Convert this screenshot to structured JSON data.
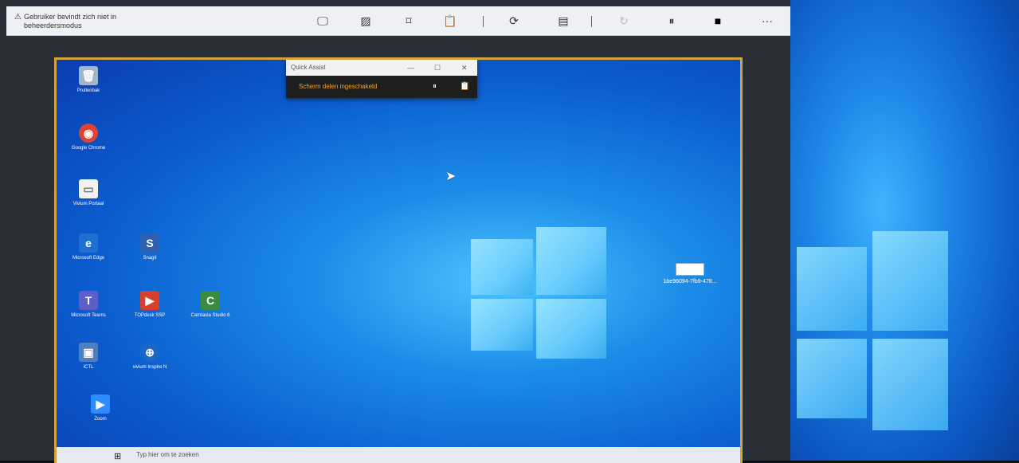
{
  "toolbar": {
    "warning_line1": "Gebruiker bevindt zich niet in",
    "warning_line2": "beheerdersmodus",
    "warning_icon": "⚠",
    "buttons": [
      {
        "name": "monitor-icon",
        "glyph": "🖵"
      },
      {
        "name": "annotate-icon",
        "glyph": "▨"
      },
      {
        "name": "fit-screen-icon",
        "glyph": "⌑"
      },
      {
        "name": "clipboard-icon",
        "glyph": "📋"
      },
      {
        "name": "restart-icon",
        "glyph": "⟳"
      },
      {
        "name": "task-manager-icon",
        "glyph": "▤"
      },
      {
        "name": "reconnect-icon",
        "glyph": "↻"
      },
      {
        "name": "pause-icon",
        "glyph": "⏸"
      },
      {
        "name": "stop-icon",
        "glyph": "■"
      },
      {
        "name": "more-icon",
        "glyph": "···"
      }
    ]
  },
  "quick_assist": {
    "title": "Quick Assist",
    "status": "Scherm delen ingeschakeld",
    "minimize": "—",
    "maximize": "☐",
    "close": "✕",
    "pause": "⏸",
    "clipboard": "📋"
  },
  "desktop_icons": [
    {
      "label": "Prullenbak",
      "glyph": "🗑",
      "color": "#9fb6cc"
    },
    {
      "label": "Google Chrome",
      "glyph": "◉",
      "color": "#db4437"
    },
    {
      "label": "Vivium Portaal",
      "glyph": "▭",
      "color": "#f2f2f2"
    },
    {
      "label": "Microsoft Edge",
      "glyph": "e",
      "color": "#1f6fd1"
    },
    {
      "label": "Snagit",
      "glyph": "S",
      "color": "#2f5fb0"
    },
    {
      "label": "Microsoft Teams",
      "glyph": "T",
      "color": "#5b5fc7"
    },
    {
      "label": "TOPdesk SSP",
      "glyph": "▶",
      "color": "#d6402d"
    },
    {
      "label": "Camtasia Studio 8",
      "glyph": "C",
      "color": "#3a8a3f"
    },
    {
      "label": "ICTL",
      "glyph": "▣",
      "color": "#4f7fbf"
    },
    {
      "label": "vivium Inspire N",
      "glyph": "⊕",
      "color": "#1b66c9"
    },
    {
      "label": "Zoom",
      "glyph": "▶",
      "color": "#2d8cff"
    }
  ],
  "file_item": {
    "label": "1be96094-7fb9-478..."
  },
  "taskbar": {
    "start_icon": "⊞",
    "search_text": "Typ hier om te zoeken"
  }
}
